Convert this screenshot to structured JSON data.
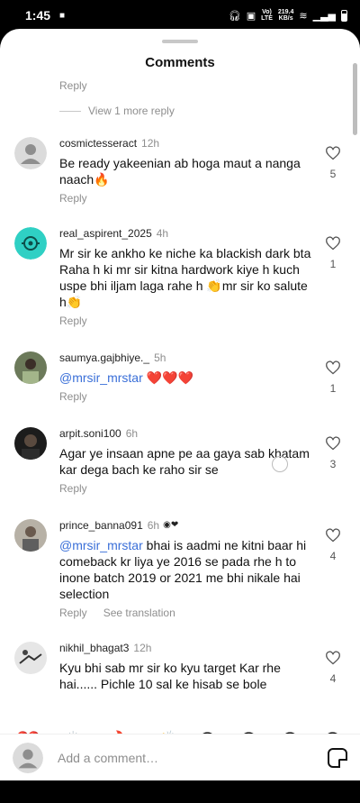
{
  "status": {
    "time": "1:45",
    "network_top": "Vo)",
    "network_bottom": "LTE",
    "speed_top": "219.4",
    "speed_bottom": "KB/s"
  },
  "sheet": {
    "title": "Comments"
  },
  "previous": {
    "reply": "Reply",
    "view_more": "View 1 more reply"
  },
  "comments": [
    {
      "user": "cosmictesseract",
      "time": "12h",
      "text": "Be ready yakeenian ab hoga maut a nanga naach🔥",
      "reply": "Reply",
      "likes": "5",
      "avatar": "default"
    },
    {
      "user": "real_aspirent_2025",
      "time": "4h",
      "text": "Mr sir ke ankho ke niche ka blackish dark bta Raha h ki mr sir kitna hardwork kiye h kuch uspe bhi iljam laga rahe h 👏mr sir ko salute h👏",
      "reply": "Reply",
      "likes": "1",
      "avatar": "teal"
    },
    {
      "user": "saumya.gajbhiye._",
      "time": "5h",
      "mention": "@mrsir_mrstar",
      "text": " ❤️❤️❤️",
      "reply": "Reply",
      "likes": "1",
      "avatar": "photo-green"
    },
    {
      "user": "arpit.soni100",
      "time": "6h",
      "text": "Agar ye insaan apne pe aa gaya sab khatam kar dega bach ke raho sir se",
      "reply": "Reply",
      "likes": "3",
      "avatar": "photo-dark"
    },
    {
      "user": "prince_banna091",
      "time": "6h",
      "mention": "@mrsir_mrstar",
      "text": " bhai is aadmi ne kitni baar hi comeback kr liya ye 2016 se pada rhe h to inone batch 2019 or 2021 me bhi nikale hai selection",
      "reply": "Reply",
      "see_translation": "See translation",
      "likes": "4",
      "avatar": "photo-grey"
    },
    {
      "user": "nikhil_bhagat3",
      "time": "12h",
      "text": "Kyu bhi sab mr sir ko kyu target Kar rhe hai...... Pichle 10 sal ke hisab se bole",
      "likes": "4",
      "avatar": "photo-light"
    }
  ],
  "emoji_bar": [
    "❤️",
    "🙌",
    "🔥",
    "👏",
    "😢",
    "😍",
    "😮",
    "😂"
  ],
  "composer": {
    "placeholder": "Add a comment…"
  }
}
